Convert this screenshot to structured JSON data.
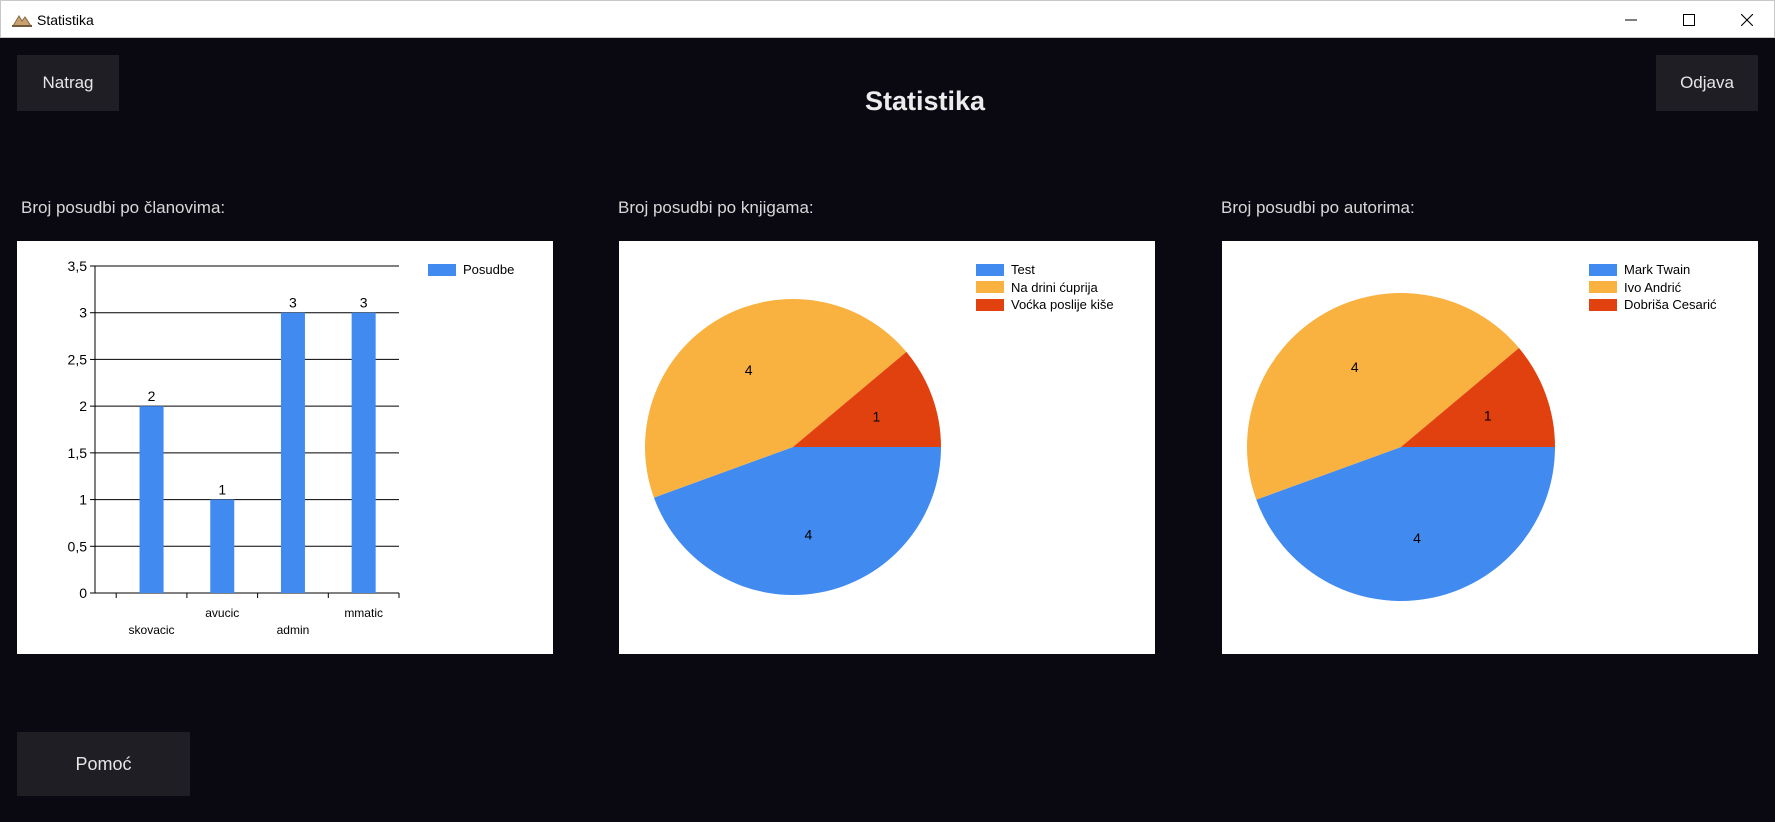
{
  "window": {
    "title": "Statistika",
    "controls": {
      "minimize": "—",
      "maximize": "☐",
      "close": "✕"
    }
  },
  "header": {
    "back_label": "Natrag",
    "title": "Statistika",
    "logout_label": "Odjava"
  },
  "footer": {
    "help_label": "Pomoć"
  },
  "colors": {
    "background": "#0a0912",
    "button": "#1f1e25",
    "blue": "#418af0",
    "orange": "#f9b140",
    "red": "#e1410f"
  },
  "sections": [
    {
      "label": "Broj posudbi po članovima:"
    },
    {
      "label": "Broj posudbi po knjigama:"
    },
    {
      "label": "Broj posudbi po autorima:"
    }
  ],
  "chart_data": [
    {
      "type": "bar",
      "categories": [
        "skovacic",
        "avucic",
        "admin",
        "mmatic"
      ],
      "series": [
        {
          "name": "Posudbe",
          "values": [
            2,
            1,
            3,
            3
          ],
          "color": "#418af0"
        }
      ],
      "ylim": [
        0,
        3.5
      ],
      "yticks": [
        0,
        0.5,
        1,
        1.5,
        2,
        2.5,
        3,
        3.5
      ],
      "ytick_labels": [
        "0",
        "0,5",
        "1",
        "1,5",
        "2",
        "2,5",
        "3",
        "3,5"
      ],
      "data_labels": [
        "2",
        "1",
        "3",
        "3"
      ],
      "grid": true,
      "legend": "top-right"
    },
    {
      "type": "pie",
      "labels": [
        "Test",
        "Na drini ćuprija",
        "Voćka poslije kiše"
      ],
      "values": [
        4,
        4,
        1
      ],
      "colors": [
        "#418af0",
        "#f9b140",
        "#e1410f"
      ],
      "data_labels": [
        "4",
        "4",
        "1"
      ],
      "legend": "top-right"
    },
    {
      "type": "pie",
      "labels": [
        "Mark Twain",
        "Ivo Andrić",
        "Dobriša Cesarić"
      ],
      "values": [
        4,
        4,
        1
      ],
      "colors": [
        "#418af0",
        "#f9b140",
        "#e1410f"
      ],
      "data_labels": [
        "4",
        "4",
        "1"
      ],
      "legend": "top-right"
    }
  ]
}
